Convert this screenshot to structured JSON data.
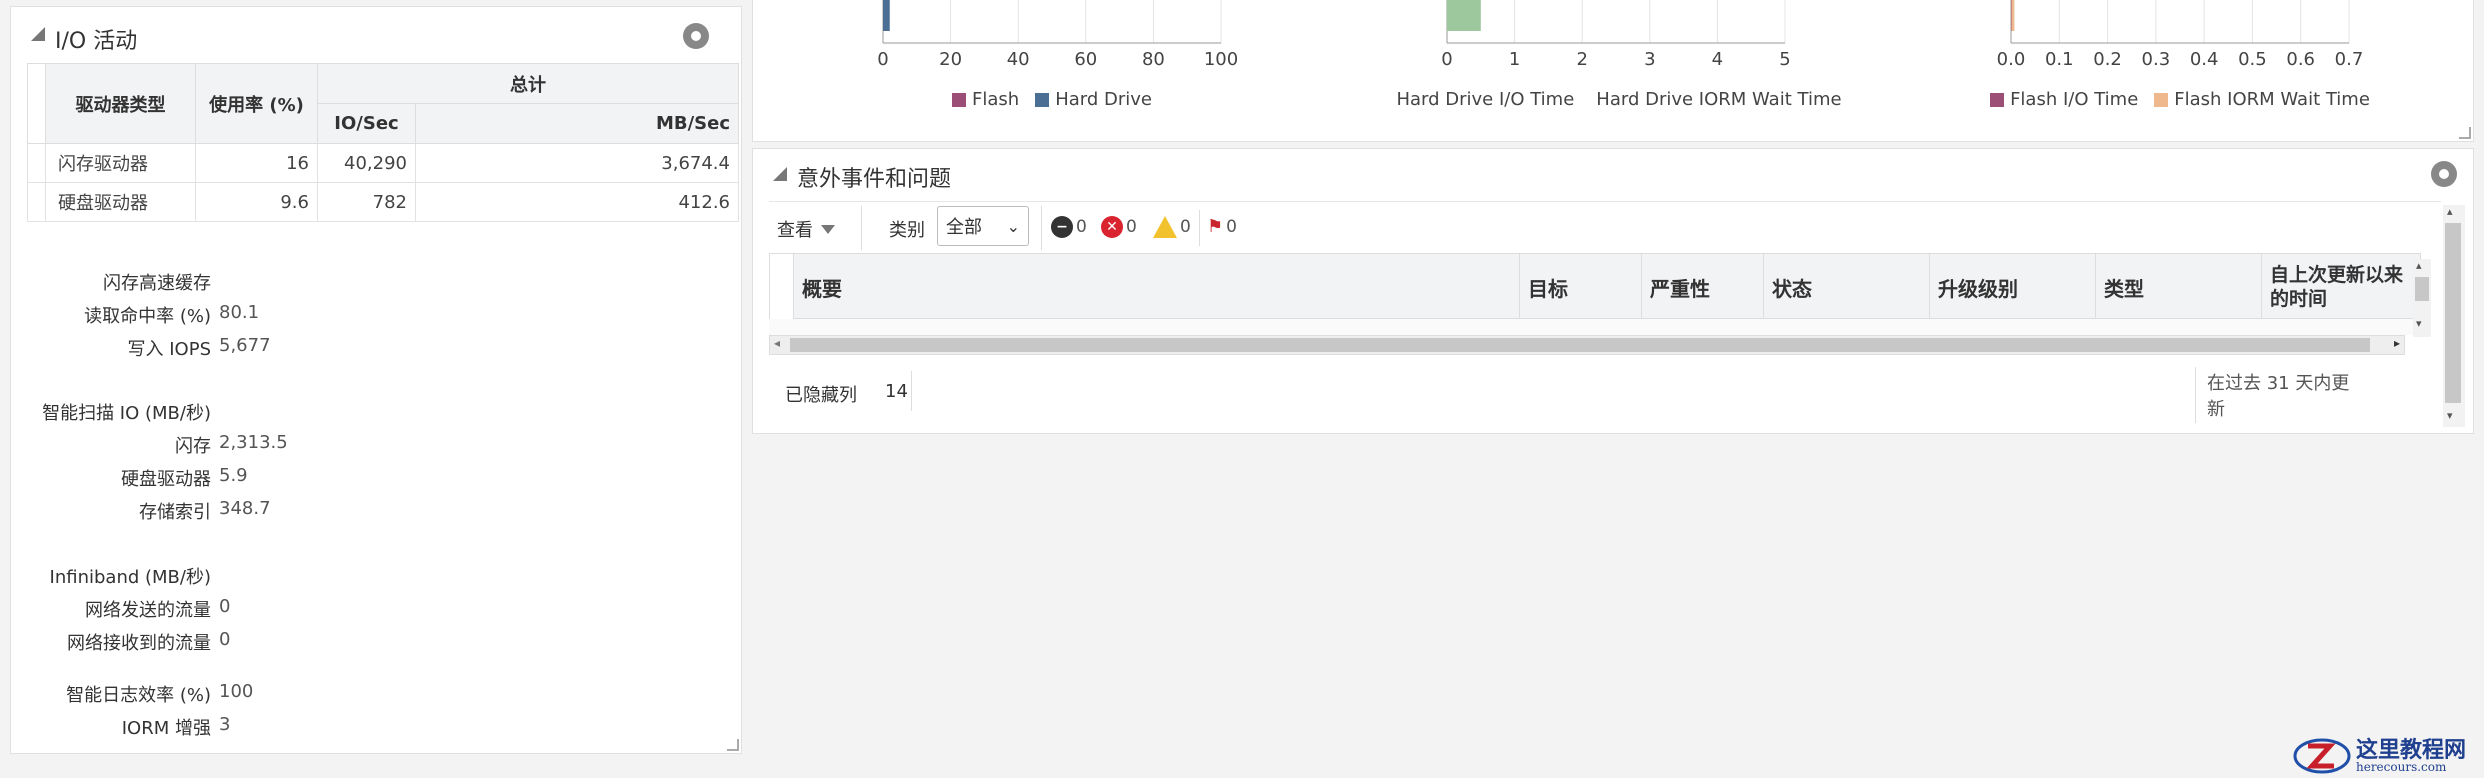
{
  "io_panel": {
    "title": "I/O 活动",
    "table": {
      "col_type": "驱动器类型",
      "col_util": "使用率 (%)",
      "col_total": "总计",
      "col_io": "IO/Sec",
      "col_mb": "MB/Sec",
      "rows": [
        {
          "type": "闪存驱动器",
          "util": "16",
          "io": "40,290",
          "mb": "3,674.4"
        },
        {
          "type": "硬盘驱动器",
          "util": "9.6",
          "io": "782",
          "mb": "412.6"
        }
      ]
    },
    "flash_cache": {
      "heading": "闪存高速缓存",
      "read_hit_label": "读取命中率 (%)",
      "read_hit_value": "80.1",
      "write_iops_label": "写入 IOPS",
      "write_iops_value": "5,677"
    },
    "smart_scan": {
      "heading": "智能扫描 IO (MB/秒)",
      "flash_label": "闪存",
      "flash_value": "2,313.5",
      "hdd_label": "硬盘驱动器",
      "hdd_value": "5.9",
      "index_label": "存储索引",
      "index_value": "348.7"
    },
    "infiniband": {
      "heading": "Infiniband (MB/秒)",
      "sent_label": "网络发送的流量",
      "sent_value": "0",
      "recv_label": "网络接收到的流量",
      "recv_value": "0"
    },
    "smart_log_label": "智能日志效率 (%)",
    "smart_log_value": "100",
    "iorm_label": "IORM 增强",
    "iorm_value": "3"
  },
  "chart_data": [
    {
      "type": "bar",
      "orientation": "horizontal",
      "categories": [
        ""
      ],
      "series": [
        {
          "name": "Flash",
          "values": [
            0
          ],
          "color": "#9b4f76"
        },
        {
          "name": "Hard Drive",
          "values": [
            2
          ],
          "color": "#4b6f94"
        }
      ],
      "x_ticks": [
        "0",
        "20",
        "40",
        "60",
        "80",
        "100"
      ],
      "xlim": [
        0,
        100
      ],
      "legend": "bottom",
      "grid": true
    },
    {
      "type": "bar",
      "orientation": "horizontal",
      "categories": [
        ""
      ],
      "series": [
        {
          "name": "Hard Drive I/O Time",
          "values": [
            0
          ],
          "color": "#4b6f94"
        },
        {
          "name": "Hard Drive IORM Wait Time",
          "values": [
            0.5
          ],
          "color": "#9dc79c"
        }
      ],
      "x_ticks": [
        "0",
        "1",
        "2",
        "3",
        "4",
        "5"
      ],
      "xlim": [
        0,
        5
      ],
      "legend": "bottom",
      "grid": true
    },
    {
      "type": "bar",
      "orientation": "horizontal",
      "categories": [
        ""
      ],
      "series": [
        {
          "name": "Flash I/O Time",
          "values": [
            0.001
          ],
          "color": "#9b4f76"
        },
        {
          "name": "Flash IORM Wait Time",
          "values": [
            0.006
          ],
          "color": "#f0b98d"
        }
      ],
      "x_ticks": [
        "0.0",
        "0.1",
        "0.2",
        "0.3",
        "0.4",
        "0.5",
        "0.6",
        "0.7"
      ],
      "xlim": [
        0,
        0.7
      ],
      "legend": "bottom",
      "grid": true
    }
  ],
  "incidents_panel": {
    "title": "意外事件和问题",
    "toolbar": {
      "view_label": "查看",
      "category_label": "类别",
      "category_value": "全部",
      "fatal_count": "0",
      "critical_count": "0",
      "warning_count": "0",
      "escalated_count": "0"
    },
    "columns": {
      "summary": "概要",
      "target": "目标",
      "severity": "严重性",
      "status": "状态",
      "escalation": "升级级别",
      "type": "类型",
      "last_updated": "自上次更新以来的时间"
    },
    "footer": {
      "hidden_cols_label": "已隐藏列",
      "hidden_cols_value": "14",
      "time_range": "在过去 31 天内更新"
    }
  },
  "watermark": {
    "cn": "这里教程网",
    "url": "herecours.com"
  },
  "colors": {
    "flash": "#9b4f76",
    "hard_drive": "#4b6f94",
    "iorm_wait": "#9dc79c",
    "flash_iorm_wait": "#f0b98d"
  }
}
